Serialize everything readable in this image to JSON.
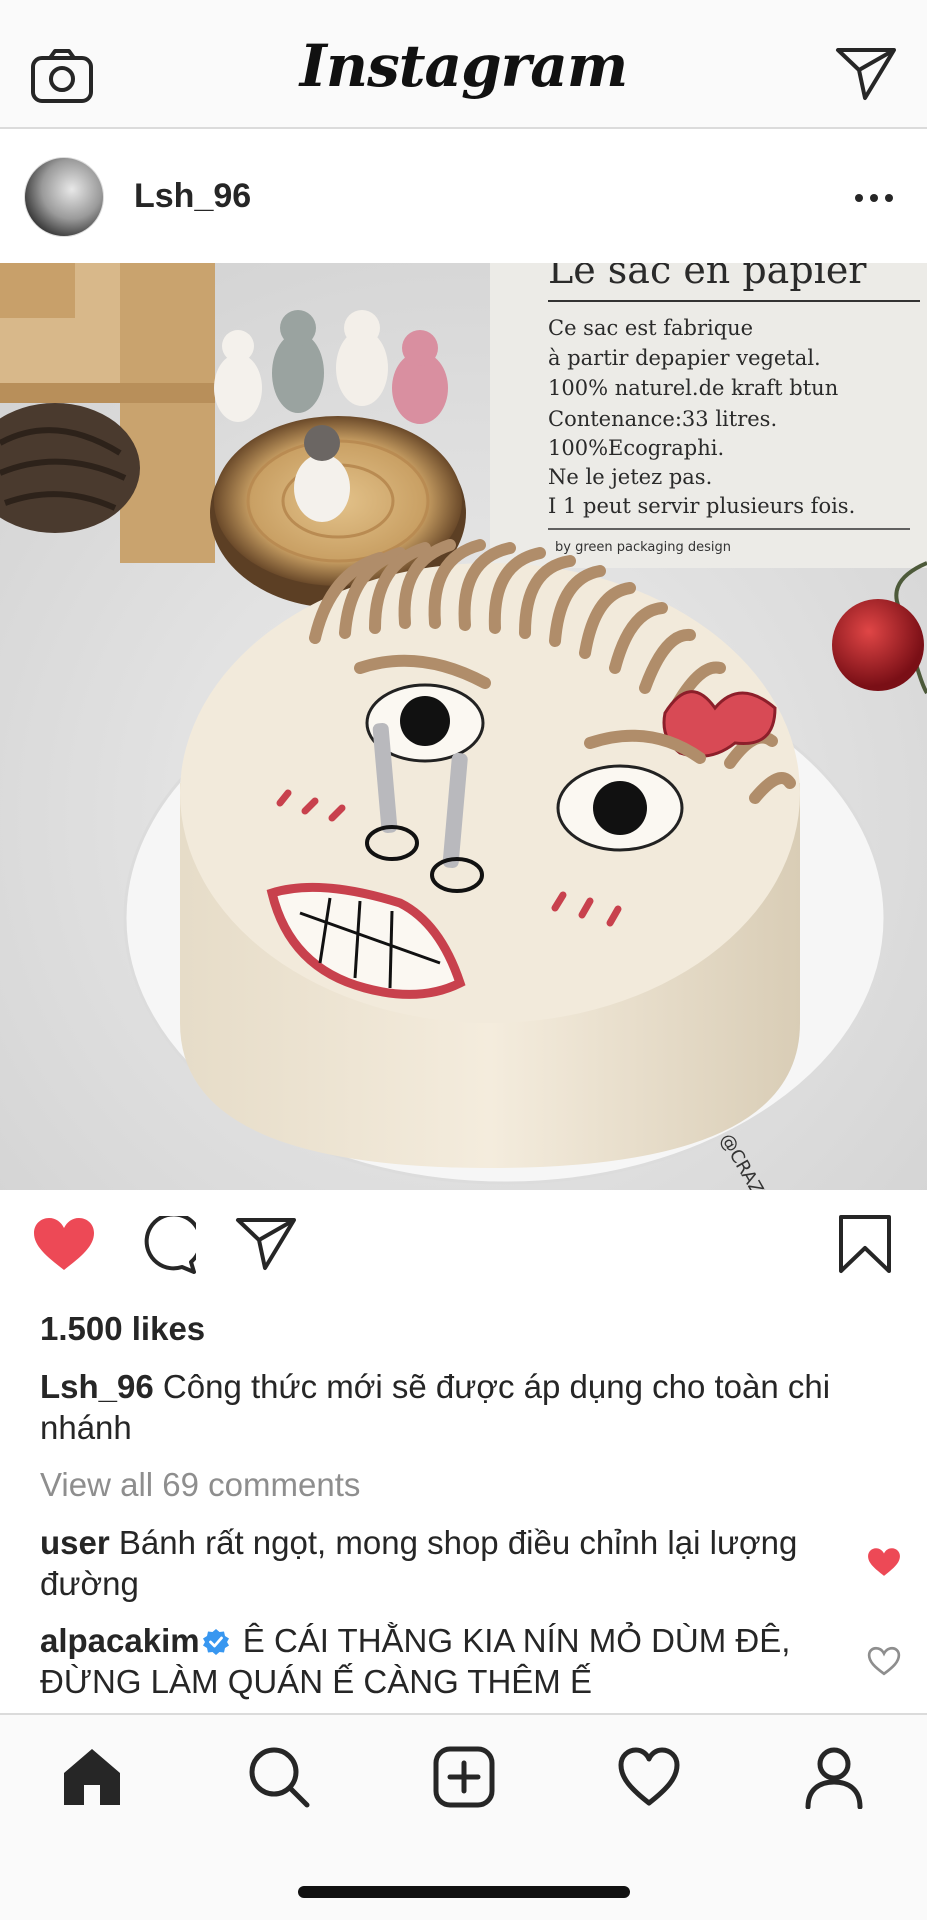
{
  "app": {
    "title": "Instagram",
    "camera_icon": "camera-icon",
    "direct_icon": "paper-plane-icon"
  },
  "post": {
    "username": "Lsh_96",
    "more_icon": "more-dots-icon",
    "photo": {
      "sign_title": "Le sac en papier",
      "sign_lines": [
        "Ce sac est fabrique",
        "à partir depapier vegetal.",
        "100% naturel.de kraft btun",
        "Contenance:33 litres.",
        "100%Ecographi.",
        "Ne le jetez pas.",
        "I 1 peut servir plusieurs fois."
      ],
      "sign_footer": "by green packaging design",
      "watermark": "@CRAZY"
    },
    "liked": true,
    "likes": "1.500 likes",
    "caption_user": "Lsh_96",
    "caption_text": "Công thức mới sẽ được áp dụng cho toàn chi nhánh",
    "view_all": "View all 69 comments",
    "comments": [
      {
        "user": "user",
        "text": "Bánh rất ngọt, mong shop điều chỉnh lại lượng đường",
        "verified": false,
        "liked": true
      },
      {
        "user": "alpacakim",
        "text": "Ê CÁI THẰNG KIA NÍN MỎ DÙM ĐÊ, ĐỪNG LÀM QUÁN Ế CÀNG THÊM Ế",
        "verified": true,
        "liked": false
      }
    ]
  },
  "colors": {
    "like_red": "#ed4956",
    "verified_blue": "#3897f0",
    "muted_text": "#8e8e8e"
  },
  "bottom_nav": {
    "items": [
      "home-icon",
      "search-icon",
      "new-post-icon",
      "activity-heart-icon",
      "profile-icon"
    ],
    "active": "home-icon"
  }
}
